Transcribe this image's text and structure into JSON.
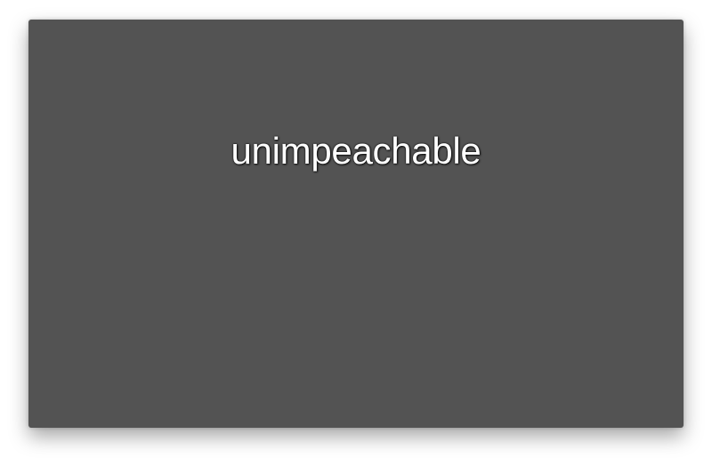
{
  "card": {
    "word": "unimpeachable",
    "background": "#535353"
  }
}
